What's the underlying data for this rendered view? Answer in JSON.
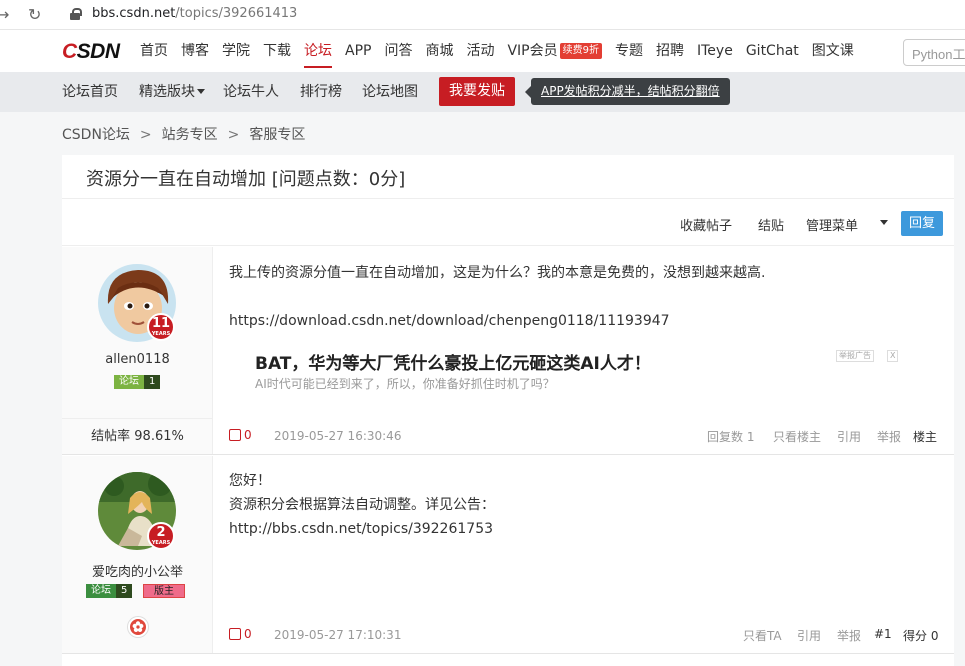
{
  "browser": {
    "url_host": "bbs.csdn.net",
    "url_path": "/topics/392661413",
    "back_icon": "back-arrow-icon",
    "reload_icon": "reload-icon"
  },
  "topnav": {
    "logo": "CSDN",
    "items": [
      "首页",
      "博客",
      "学院",
      "下载",
      "论坛",
      "APP",
      "问答",
      "商城",
      "活动",
      "VIP会员",
      "专题",
      "招聘",
      "ITeye",
      "GitChat",
      "图文课"
    ],
    "active": "论坛",
    "vip_badge": "续费9折",
    "search_placeholder": "Python工"
  },
  "subnav": {
    "items": [
      "论坛首页",
      "精选版块",
      "论坛牛人",
      "排行榜",
      "论坛地图"
    ],
    "post_button": "我要发贴",
    "tooltip": "APP发帖积分减半，结帖积分翻倍"
  },
  "breadcrumb": [
    "CSDN论坛",
    "站务专区",
    "客服专区"
  ],
  "thread": {
    "title": "资源分一直在自动增加 [问题点数：0分]",
    "toolbar": {
      "favorite": "收藏帖子",
      "close": "结贴",
      "manage": "管理菜单",
      "reply": "回复"
    }
  },
  "posts": [
    {
      "username": "allen0118",
      "years": "11",
      "years_label": "YEARS",
      "forum_badge": "论坛",
      "forum_level": "1",
      "close_rate": "结帖率 98.61%",
      "content": [
        "我上传的资源分值一直在自动增加，这是为什么？我的本意是免费的，没想到越来越高.",
        "",
        "https://download.csdn.net/download/chenpeng0118/11193947"
      ],
      "ad_title": "BAT，华为等大厂凭什么豪投上亿元砸这类AI人才！",
      "ad_sub": "AI时代可能已经到来了，所以，你准备好抓住时机了吗？",
      "ad_tags": [
        "举报广告",
        "X"
      ],
      "likes": "0",
      "time": "2019-05-27 16:30:46",
      "reply_count_label": "回复数",
      "reply_count": "1",
      "actions": [
        "只看楼主",
        "引用",
        "举报"
      ],
      "floor": "楼主"
    },
    {
      "username": "爱吃肉的小公举",
      "years": "2",
      "years_label": "YEARS",
      "forum_badge": "论坛",
      "forum_level": "5",
      "mod_badge": "版主",
      "medal_icon": "flower-medal-icon",
      "content": [
        "您好！",
        "资源积分会根据算法自动调整。详见公告：",
        "http://bbs.csdn.net/topics/392261753"
      ],
      "likes": "0",
      "time": "2019-05-27 17:10:31",
      "actions": [
        "只看TA",
        "引用",
        "举报"
      ],
      "floor": "#1",
      "score": "得分 0"
    }
  ]
}
